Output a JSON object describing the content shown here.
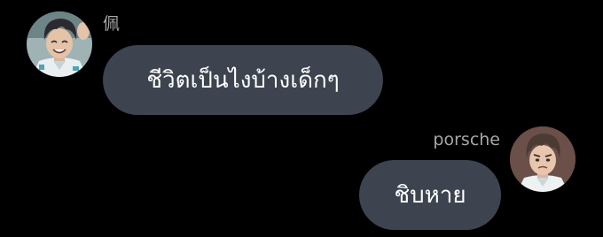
{
  "messages": [
    {
      "side": "left",
      "sender": "佩",
      "text": "ชีวิตเป็นไงบ้างเด็กๆ",
      "avatar_icon": "avatar-dark-hair-smiling-man-icon"
    },
    {
      "side": "right",
      "sender": "porsche",
      "text": "ชิบหาย",
      "avatar_icon": "avatar-brown-hair-frowning-man-icon"
    }
  ],
  "colors": {
    "background": "#000000",
    "bubble": "#3d4450",
    "bubble_text": "#ffffff",
    "sender_text": "#a7a7a7"
  }
}
